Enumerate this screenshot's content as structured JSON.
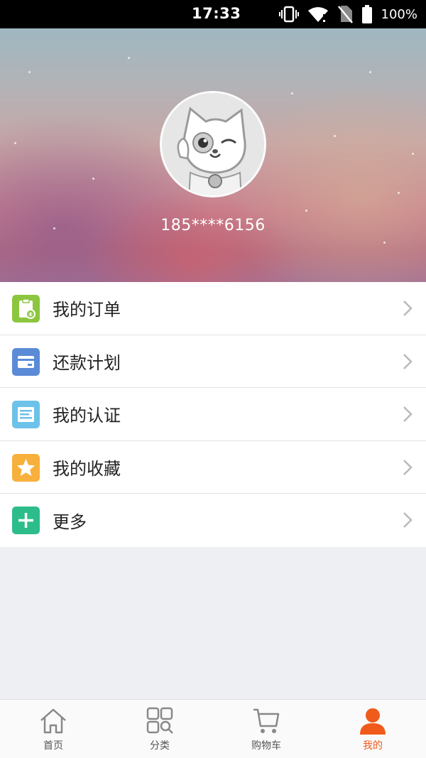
{
  "status_bar": {
    "time": "17:33",
    "battery": "100%"
  },
  "profile": {
    "phone": "185****6156"
  },
  "menu": [
    {
      "label": "我的订单",
      "icon": "orders-icon",
      "color": "#8cc63f"
    },
    {
      "label": "还款计划",
      "icon": "repayment-card-icon",
      "color": "#5b8bd6"
    },
    {
      "label": "我的认证",
      "icon": "certification-icon",
      "color": "#6cc2e8"
    },
    {
      "label": "我的收藏",
      "icon": "star-icon",
      "color": "#f7b03c"
    },
    {
      "label": "更多",
      "icon": "plus-icon",
      "color": "#2dbd8a"
    }
  ],
  "tabs": [
    {
      "label": "首页",
      "icon": "home-icon"
    },
    {
      "label": "分类",
      "icon": "category-icon"
    },
    {
      "label": "购物车",
      "icon": "cart-icon"
    },
    {
      "label": "我的",
      "icon": "profile-icon",
      "active": true
    }
  ],
  "colors": {
    "accent": "#f05a1a",
    "background": "#eeeff3"
  }
}
